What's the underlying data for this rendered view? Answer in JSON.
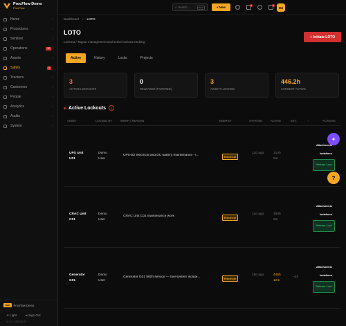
{
  "brand": {
    "name": "ProcFlow Demo",
    "sub": "ProcFlow"
  },
  "sidebar": {
    "items": [
      {
        "label": "Home",
        "icon": "home-icon"
      },
      {
        "label": "Procedures",
        "icon": "document-icon"
      },
      {
        "label": "Sentinel",
        "icon": "shield-icon"
      },
      {
        "label": "Operations",
        "icon": "clipboard-icon",
        "badge": "12"
      },
      {
        "label": "Assets",
        "icon": "cube-icon"
      },
      {
        "label": "Safety",
        "icon": "hardhat-icon",
        "badge": "3",
        "active": true
      },
      {
        "label": "Trackers",
        "icon": "tracker-icon"
      },
      {
        "label": "Customers",
        "icon": "customers-icon"
      },
      {
        "label": "People",
        "icon": "people-icon"
      },
      {
        "label": "Analytics",
        "icon": "chart-icon"
      },
      {
        "label": "Audits",
        "icon": "audit-icon"
      },
      {
        "label": "System",
        "icon": "gear-icon"
      }
    ],
    "org_tag": "VMIN",
    "org_name": "ProcFlow Demo",
    "light_label": "Light",
    "signout_label": "Sign Out",
    "version": "v1.0.0 · 2025.06.25"
  },
  "topbar": {
    "search_placeholder": "Search...",
    "search_kbd": "Ctrl K",
    "new_label": "+ New",
    "notif_count": "2",
    "alert_count": "1",
    "avatar": "DU"
  },
  "breadcrumb": {
    "root": "Dashboard",
    "current": "LOTO"
  },
  "page": {
    "title": "LOTO",
    "subtitle": "Lockout / Tagout management and active lockout tracking",
    "init_button": "Initiate LOTO"
  },
  "tabs": [
    "Active",
    "History",
    "Locks",
    "Projects"
  ],
  "stats": [
    {
      "value": "3",
      "label": "Active Lockouts",
      "color": "#ff6b4a"
    },
    {
      "value": "0",
      "label": "Released (Filtered)",
      "color": "#ffffff"
    },
    {
      "value": "3",
      "label": "Assets Locked",
      "color": "#f5a623"
    },
    {
      "value": "446.2h",
      "label": "Longest Active",
      "color": "#f5a623"
    }
  ],
  "section": {
    "title": "Active Lockouts",
    "count": "3"
  },
  "table": {
    "headers": {
      "asset": "Asset",
      "locked_by": "Locked By",
      "work": "Work / Reason",
      "energy": "Energy",
      "started": "Started",
      "active": "Active",
      "est": "Est.",
      "more": "↑",
      "actions": "Actions"
    },
    "attach_label": "Attachments",
    "isolation_label": "Isolations",
    "release_label": "Release Lock",
    "rows": [
      {
        "asset": "UPS Unit U01",
        "locked_by": "Demo User",
        "work": "UPS-B2 electrical and DC battery maintenance - f...",
        "energy": "Electrical",
        "started": "13d ago",
        "active": "314h 5m",
        "active_warn": false,
        "est": ""
      },
      {
        "asset": "CRAC Unit C01",
        "locked_by": "Demo User",
        "work": "CRAC Unit C01 maintenance work",
        "energy": "Electrical",
        "started": "14d ago",
        "active": "354h 6m",
        "active_warn": false,
        "est": ""
      },
      {
        "asset": "Generator G01",
        "locked_by": "Demo User",
        "work": "Generator G01 500h service — fuel system isolate...",
        "energy": "Electrical",
        "started": "18d ago",
        "active": "446h 12m",
        "active_warn": true,
        "est": "~4h"
      }
    ]
  },
  "fab": {
    "help": "?"
  }
}
